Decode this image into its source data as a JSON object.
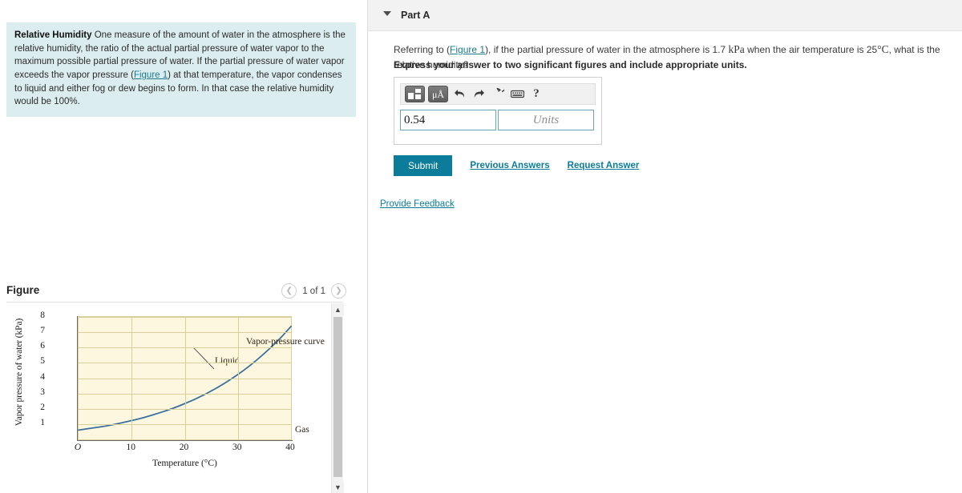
{
  "intro": {
    "term": "Relative Humidity",
    "body_1": " One measure of the amount of water in the atmosphere is the relative humidity, the ratio of the actual partial pressure of water vapor to the maximum possible partial pressure of water. If the partial pressure of water vapor exceeds the vapor pressure (",
    "figure_link": "Figure 1",
    "body_2": ") at that temperature, the vapor condenses to liquid and either fog or dew begins to form. In that case the relative humidity would be 100%."
  },
  "figure_panel": {
    "title": "Figure",
    "prev_icon": "chevron-left-icon",
    "next_icon": "chevron-right-icon",
    "counter": "1 of 1",
    "scroll_up_icon": "chevron-up-icon",
    "scroll_down_icon": "chevron-down-icon"
  },
  "chart_data": {
    "type": "line",
    "title": "",
    "xlabel": "Temperature (°C)",
    "ylabel": "Vapor pressure of water (kPa)",
    "xlim": [
      0,
      40
    ],
    "ylim": [
      0,
      8
    ],
    "xticks": [
      "O",
      "10",
      "20",
      "30",
      "40"
    ],
    "xtick_values": [
      0,
      10,
      20,
      30,
      40
    ],
    "yticks": [
      "1",
      "2",
      "3",
      "4",
      "5",
      "6",
      "7",
      "8"
    ],
    "ytick_values": [
      1,
      2,
      3,
      4,
      5,
      6,
      7,
      8
    ],
    "grid": true,
    "legend": "none",
    "plot_bg": "#fdf7e0",
    "line_color": "#3b6f9e",
    "series": [
      {
        "name": "Vapor-pressure curve",
        "x": [
          0,
          2,
          4,
          6,
          8,
          10,
          12,
          14,
          16,
          18,
          20,
          22,
          24,
          25,
          26,
          28,
          30,
          32,
          34,
          36,
          38,
          40
        ],
        "y": [
          0.61,
          0.71,
          0.81,
          0.93,
          1.07,
          1.23,
          1.4,
          1.6,
          1.82,
          2.06,
          2.34,
          2.64,
          2.98,
          3.17,
          3.36,
          3.78,
          4.24,
          4.75,
          5.32,
          5.94,
          6.62,
          7.38
        ]
      }
    ],
    "annotations": [
      {
        "text": "Liquid",
        "x": 10,
        "y": 5.3
      },
      {
        "text": "Gas",
        "x": 30,
        "y": 1.6
      },
      {
        "text": "Vapor-pressure curve",
        "x": 20,
        "y": 6.6
      }
    ]
  },
  "part": {
    "caret_icon": "triangle-down-icon",
    "title": "Part A",
    "question_pre": "Referring to (",
    "question_link": "Figure 1",
    "question_mid": "), if the partial pressure of water in the atmosphere is 1.7 ",
    "question_unit_1": "kPa",
    "question_mid_2": " when the air temperature is 25",
    "question_unit_2": "°C",
    "question_post": ", what is the relative humidity?",
    "instruction": "Express your answer to two significant figures and include appropriate units."
  },
  "answer": {
    "toolbar": {
      "template_icon": "template-layout-icon",
      "units_icon": "micro-angstrom-units-icon",
      "units_label": "μA",
      "undo_icon": "undo-arrow-icon",
      "redo_icon": "redo-arrow-icon",
      "reset_icon": "reset-circular-arrow-icon",
      "keyboard_icon": "keyboard-icon",
      "help_icon": "question-mark-icon",
      "help_label": "?"
    },
    "value": "0.54",
    "units_placeholder": "Units"
  },
  "actions": {
    "submit_label": "Submit",
    "previous_answers_label": "Previous Answers",
    "request_answer_label": "Request Answer",
    "provide_feedback_label": "Provide Feedback",
    "accent_color": "#0b7c99"
  }
}
